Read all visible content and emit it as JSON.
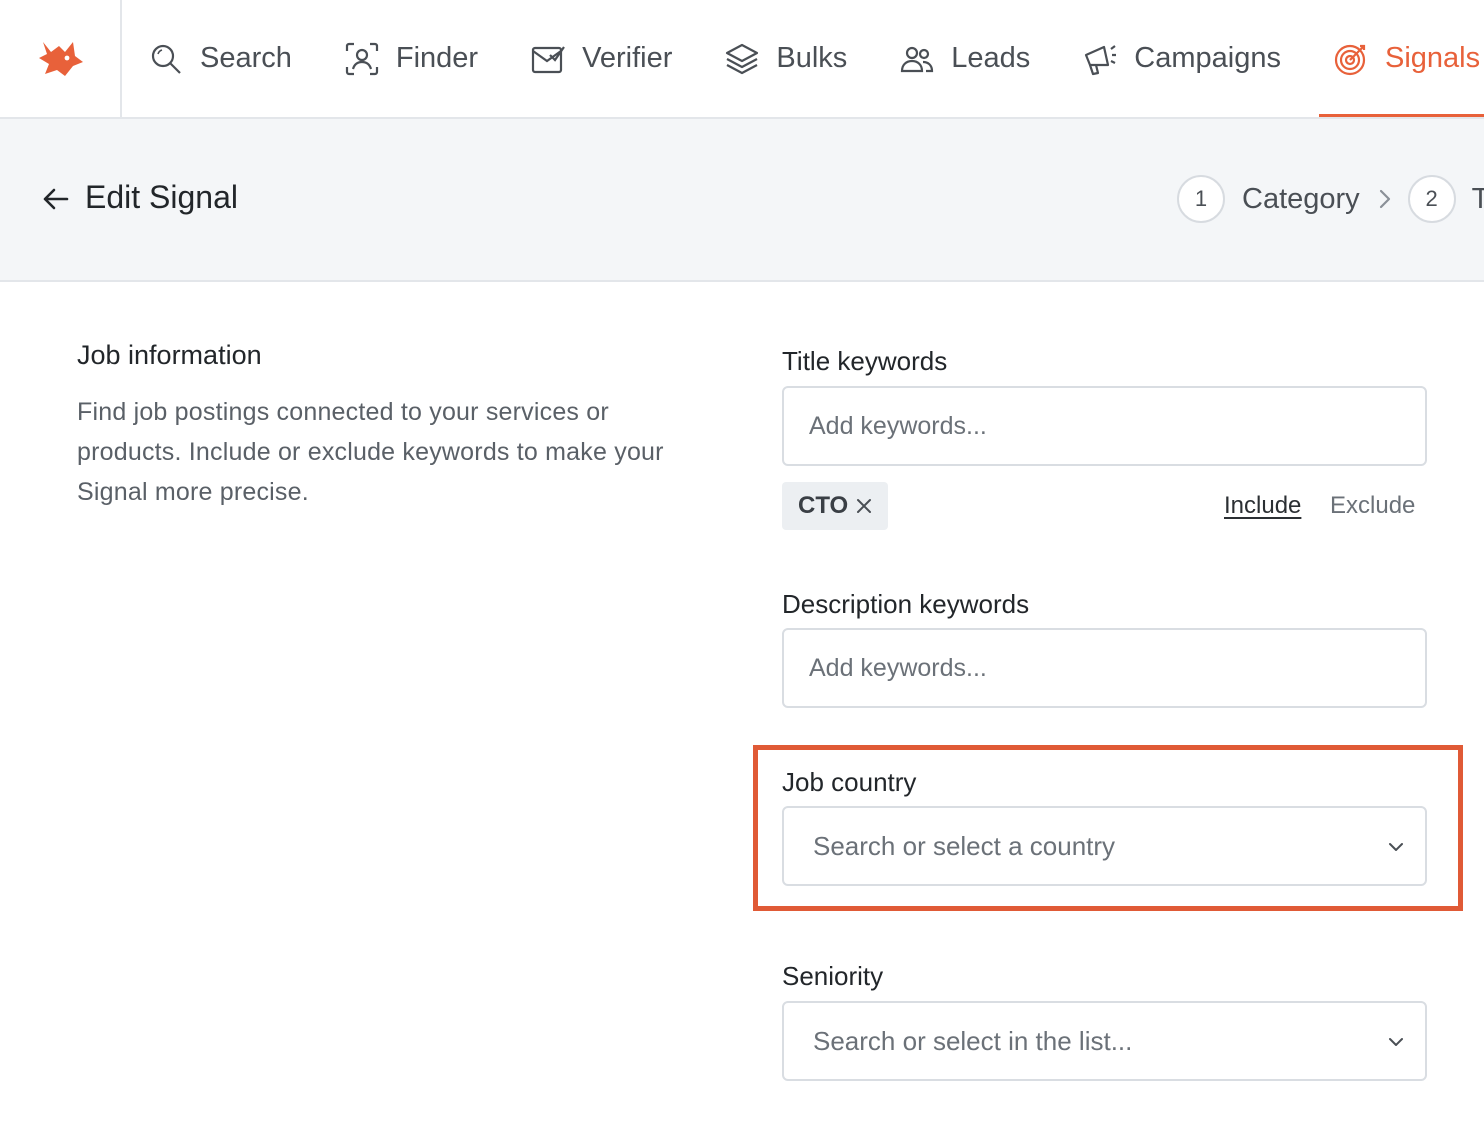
{
  "nav": {
    "logo_icon": "fox-logo-icon",
    "items": [
      {
        "label": "Search",
        "icon": "search-icon"
      },
      {
        "label": "Finder",
        "icon": "finder-icon"
      },
      {
        "label": "Verifier",
        "icon": "verifier-icon"
      },
      {
        "label": "Bulks",
        "icon": "layers-icon"
      },
      {
        "label": "Leads",
        "icon": "users-icon"
      },
      {
        "label": "Campaigns",
        "icon": "megaphone-icon"
      },
      {
        "label": "Signals",
        "icon": "target-icon",
        "active": true
      }
    ]
  },
  "header": {
    "title": "Edit Signal",
    "steps": [
      {
        "number": "1",
        "label": "Category"
      },
      {
        "number": "2",
        "label": "T"
      }
    ]
  },
  "section": {
    "title": "Job information",
    "description": "Find job postings connected to your services or products. Include or exclude keywords to make your Signal more precise."
  },
  "form": {
    "title_keywords": {
      "label": "Title keywords",
      "placeholder": "Add keywords...",
      "chips": [
        "CTO"
      ],
      "include_label": "Include",
      "exclude_label": "Exclude",
      "mode": "Include"
    },
    "description_keywords": {
      "label": "Description keywords",
      "placeholder": "Add keywords..."
    },
    "job_country": {
      "label": "Job country",
      "placeholder": "Search or select a country"
    },
    "seniority": {
      "label": "Seniority",
      "placeholder": "Search or select in the list..."
    }
  },
  "colors": {
    "accent": "#e8613a",
    "highlight": "#e05a36",
    "header_bg": "#f4f6f8"
  }
}
